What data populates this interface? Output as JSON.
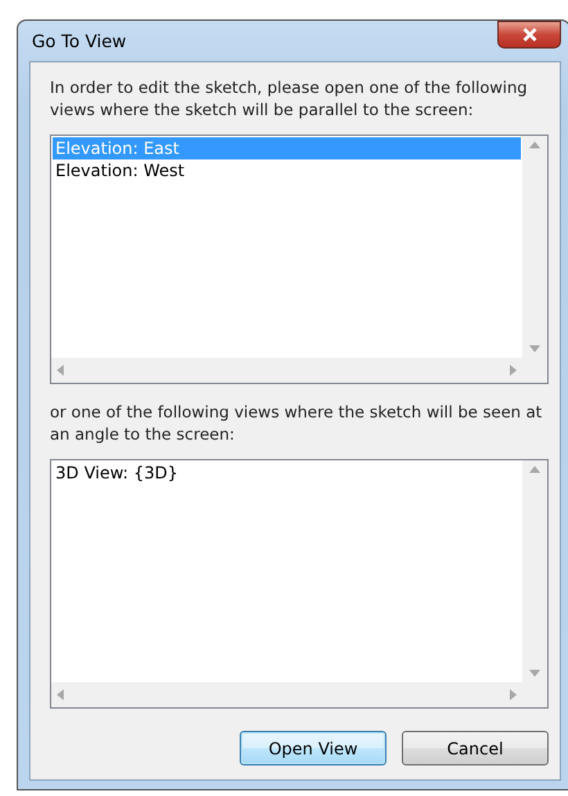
{
  "window": {
    "title": "Go To View"
  },
  "intro": "In order to edit the sketch, please open one of the following views where the sketch will be parallel to the screen:",
  "parallel_views": [
    {
      "label": "Elevation: East",
      "selected": true
    },
    {
      "label": "Elevation: West",
      "selected": false
    }
  ],
  "angle_text": "or one of the following views where the sketch will be seen at an angle to the screen:",
  "angle_views": [
    {
      "label": "3D View: {3D}",
      "selected": false
    }
  ],
  "buttons": [
    {
      "label": "Open View",
      "default": true
    },
    {
      "label": "Cancel",
      "default": false
    }
  ]
}
